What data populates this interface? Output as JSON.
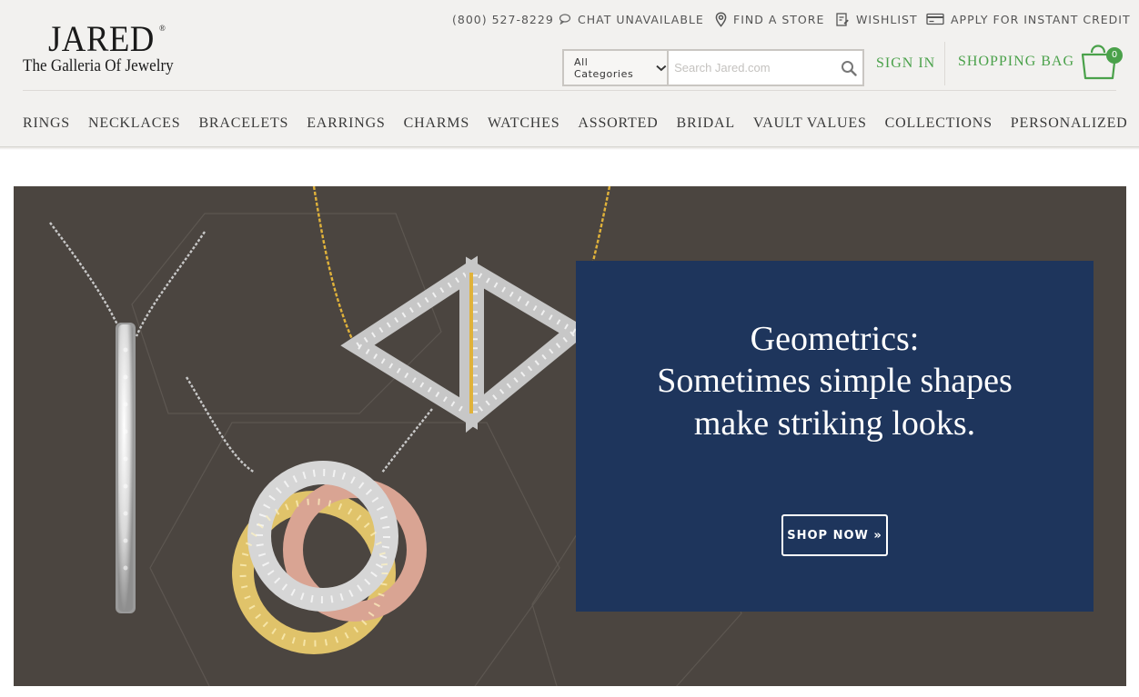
{
  "brand": {
    "name": "JARED",
    "registered": "®",
    "tagline": "The Galleria Of Jewelry"
  },
  "utility_bar": {
    "phone": "(800) 527-8229",
    "chat": "CHAT UNAVAILABLE",
    "store": "FIND A STORE",
    "wishlist": "WISHLIST",
    "credit": "APPLY FOR INSTANT CREDIT"
  },
  "search": {
    "category": "All Categories",
    "placeholder": "Search Jared.com"
  },
  "account": {
    "sign_in": "SIGN IN",
    "bag_label": "SHOPPING BAG",
    "bag_count": "0"
  },
  "nav": [
    "RINGS",
    "NECKLACES",
    "BRACELETS",
    "EARRINGS",
    "CHARMS",
    "WATCHES",
    "ASSORTED",
    "BRIDAL",
    "VAULT VALUES",
    "COLLECTIONS",
    "PERSONALIZED"
  ],
  "hero": {
    "title": "Geometrics:",
    "subtitle": "Sometimes simple shapes make striking looks.",
    "cta": "SHOP NOW »"
  },
  "colors": {
    "accent_green": "#4aa14a",
    "promo_navy": "#1e355c",
    "hero_bg": "#4b4540",
    "header_bg": "#f2f1ef"
  }
}
